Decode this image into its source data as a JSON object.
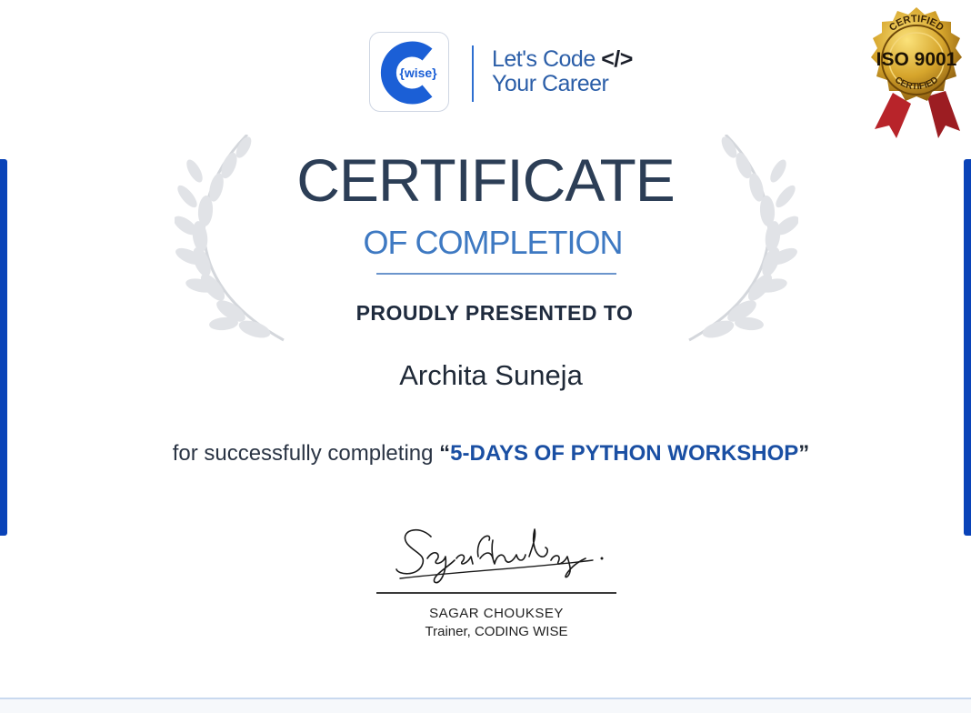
{
  "logo": {
    "brand": "{wise}",
    "tagline_line1": "Let's Code",
    "tagline_code": "</>",
    "tagline_line2": "Your Career"
  },
  "seal": {
    "top_text": "CERTIFIED",
    "main_text": "ISO 9001",
    "bottom_text": "CERTIFIED"
  },
  "certificate": {
    "title": "CERTIFICATE",
    "subtitle": "OF COMPLETION",
    "presented": "PROUDLY PRESENTED TO",
    "recipient": "Archita Suneja",
    "completion_prefix": "for successfully completing ",
    "open_quote": "“",
    "course": "5-DAYS OF PYTHON WORKSHOP",
    "close_quote": "”"
  },
  "signatory": {
    "name": "SAGAR CHOUKSEY",
    "role": "Trainer, CODING WISE"
  },
  "colors": {
    "accent_blue": "#0a43b8",
    "title": "#2c3e56",
    "subtitle": "#3e79c2",
    "course": "#1a4fa3",
    "seal_gold": "#c9951f",
    "ribbon_red": "#b8242a"
  },
  "icons": {
    "logo": "coding-wise-c-logo",
    "seal": "iso-gold-seal",
    "laurel": "laurel-wreath",
    "signature": "handwritten-signature"
  }
}
